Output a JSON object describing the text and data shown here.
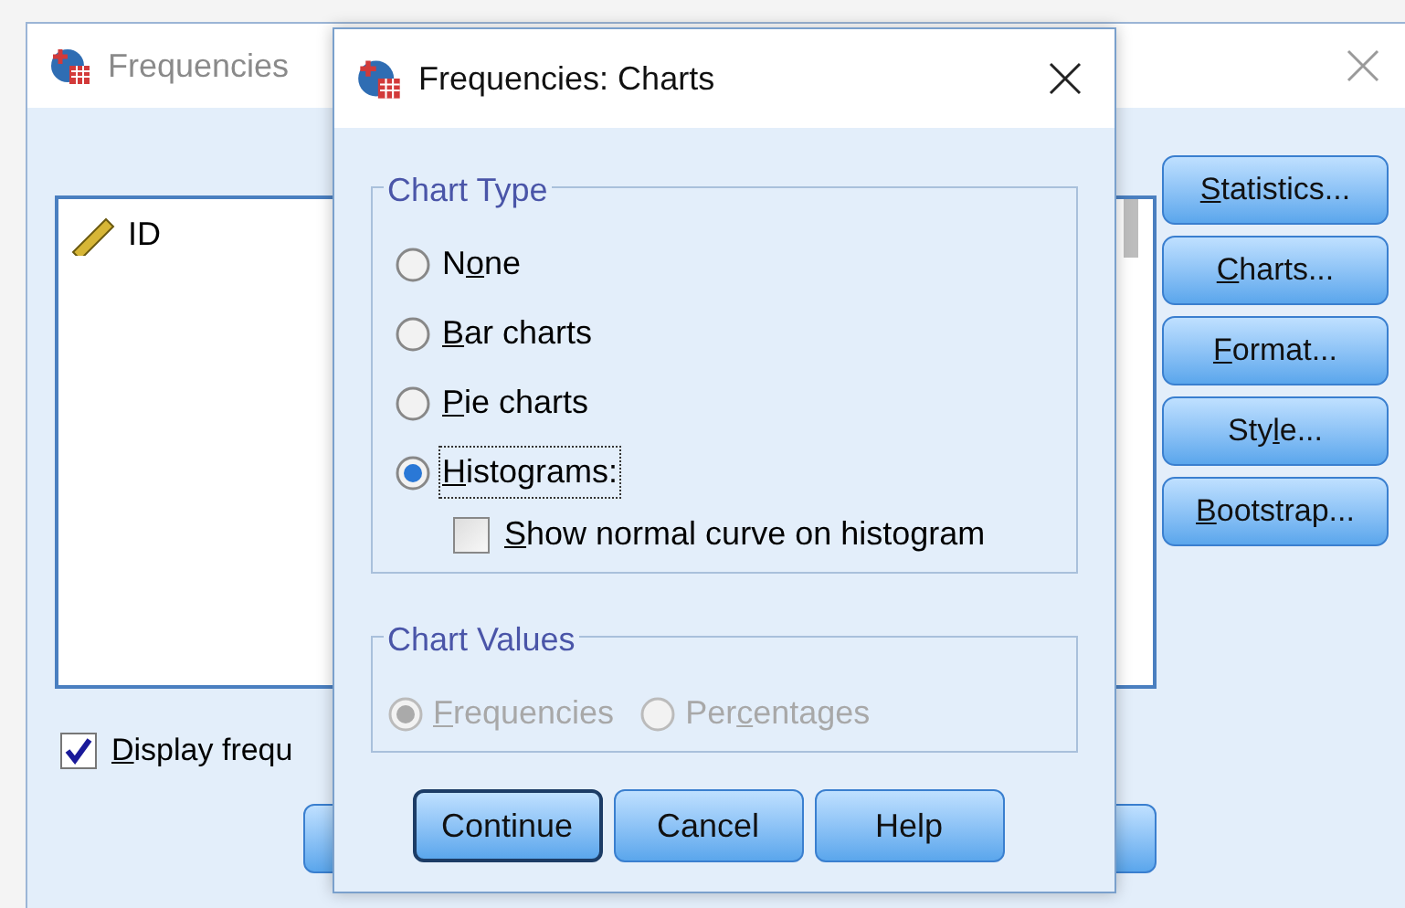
{
  "main_window": {
    "title": "Frequencies",
    "variables": [
      {
        "name": "ID",
        "selected": false
      }
    ],
    "side_buttons": [
      {
        "mnemonic": "S",
        "text_after": "tatistics..."
      },
      {
        "mnemonic": "C",
        "text_after": "harts..."
      },
      {
        "mnemonic": "F",
        "text_after": "ormat..."
      },
      {
        "text_before": "Sty",
        "mnemonic": "l",
        "text_after": "e..."
      },
      {
        "mnemonic": "B",
        "text_after": "ootstrap..."
      }
    ],
    "display_checkbox": {
      "mnemonic": "D",
      "text_after": "isplay frequ",
      "checked": true
    }
  },
  "dialog": {
    "title": "Frequencies: Charts",
    "chart_type": {
      "title": "Chart Type",
      "options": [
        {
          "text_before": "N",
          "mnemonic": "o",
          "text_after": "ne",
          "selected": false
        },
        {
          "mnemonic": "B",
          "text_after": "ar charts",
          "selected": false
        },
        {
          "mnemonic": "P",
          "text_after": "ie charts",
          "selected": false
        },
        {
          "mnemonic": "H",
          "text_after": "istograms:",
          "selected": true
        }
      ],
      "normal_curve": {
        "mnemonic": "S",
        "text_after": "how normal curve on histogram",
        "checked": false
      }
    },
    "chart_values": {
      "title": "Chart Values",
      "disabled": true,
      "options": [
        {
          "mnemonic": "F",
          "text_after": "requencies",
          "selected": true
        },
        {
          "text_before": "Per",
          "mnemonic": "c",
          "text_after": "entages",
          "selected": false
        }
      ]
    },
    "buttons": [
      {
        "label": "Continue",
        "default": true
      },
      {
        "label": "Cancel",
        "default": false
      },
      {
        "label": "Help",
        "default": false
      }
    ]
  }
}
